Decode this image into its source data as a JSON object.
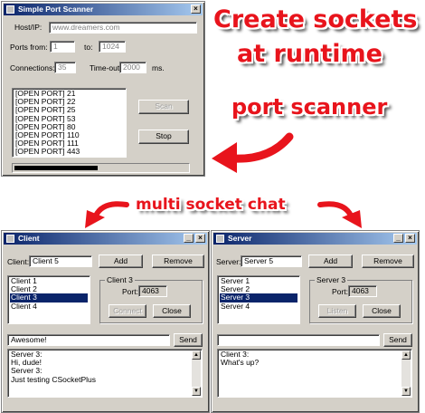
{
  "scanner": {
    "title": "Simple Port Scanner",
    "host_label": "Host/IP:",
    "host_value": "www.dreamers.com",
    "ports_from_label": "Ports from:",
    "ports_from_value": "1",
    "ports_to_label": "to:",
    "ports_to_value": "1024",
    "connections_label": "Connections:",
    "connections_value": "35",
    "timeout_label": "Time-out:",
    "timeout_value": "2000",
    "timeout_unit": "ms.",
    "results": [
      "[OPEN PORT] 21",
      "[OPEN PORT] 22",
      "[OPEN PORT] 25",
      "[OPEN PORT] 53",
      "[OPEN PORT] 80",
      "[OPEN PORT] 110",
      "[OPEN PORT] 111",
      "[OPEN PORT] 443"
    ],
    "scan_label": "Scan",
    "stop_label": "Stop",
    "progress": 0.48
  },
  "promo": {
    "line1": "Create sockets",
    "line2": "at runtime",
    "line3": "port scanner",
    "line4": "multi socket chat",
    "color": "#e8141c"
  },
  "client": {
    "title": "Client",
    "name_label": "Client:",
    "name_value": "Client 5",
    "add_label": "Add",
    "remove_label": "Remove",
    "items": [
      "Client 1",
      "Client 2",
      "Client 3",
      "Client 4"
    ],
    "selected_index": 2,
    "group_title": "Client 3",
    "port_label": "Port:",
    "port_value": "4063",
    "connect_label": "Connect",
    "close_label": "Close",
    "message_value": "Awesome!",
    "send_label": "Send",
    "log": [
      "Server 3:",
      "Hi, dude!",
      "Server 3:",
      "Just testing CSocketPlus"
    ]
  },
  "server": {
    "title": "Server",
    "name_label": "Server:",
    "name_value": "Server 5",
    "add_label": "Add",
    "remove_label": "Remove",
    "items": [
      "Server 1",
      "Server 2",
      "Server 3",
      "Server 4"
    ],
    "selected_index": 2,
    "group_title": "Server 3",
    "port_label": "Port:",
    "port_value": "4063",
    "listen_label": "Listen",
    "close_label": "Close",
    "message_value": "",
    "send_label": "Send",
    "log": [
      "Client 3:",
      "What's up?"
    ]
  },
  "icons": {
    "window_min": "minimize-icon",
    "window_close": "close-icon",
    "arrow": "curved-arrow-icon"
  }
}
